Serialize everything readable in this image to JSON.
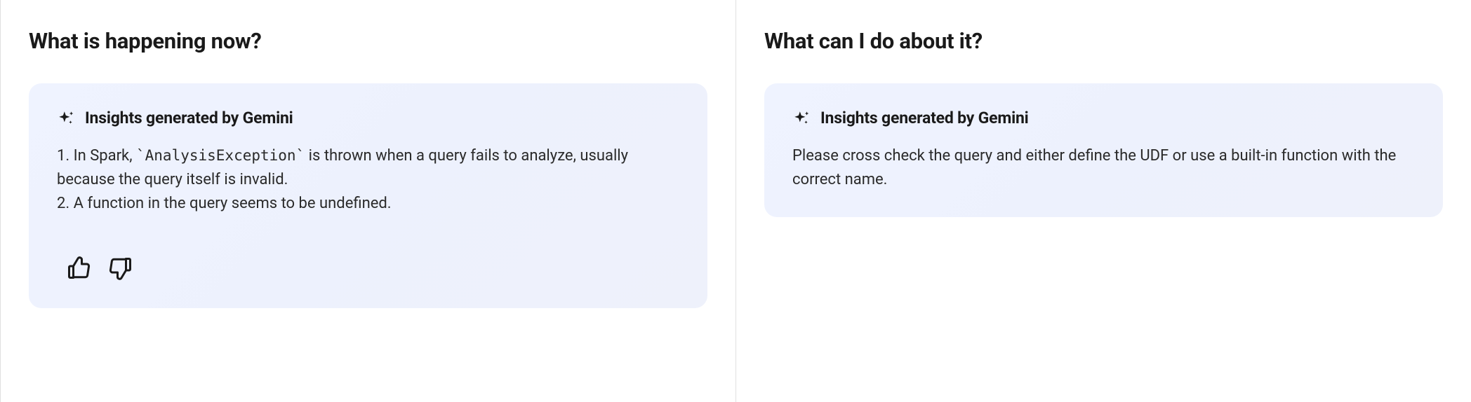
{
  "left_panel": {
    "heading": "What is happening now?",
    "insights_title": "Insights generated by Gemini",
    "line1_prefix": "1. In Spark, ",
    "line1_code": "`AnalysisException`",
    "line1_suffix": " is thrown when a query fails to analyze, usually because the query itself is invalid.",
    "line2": "2. A function in the query seems to be undefined."
  },
  "right_panel": {
    "heading": "What can I do about it?",
    "insights_title": "Insights generated by Gemini",
    "body": "Please cross check the query and either define the UDF or use a built-in function with the correct name."
  }
}
